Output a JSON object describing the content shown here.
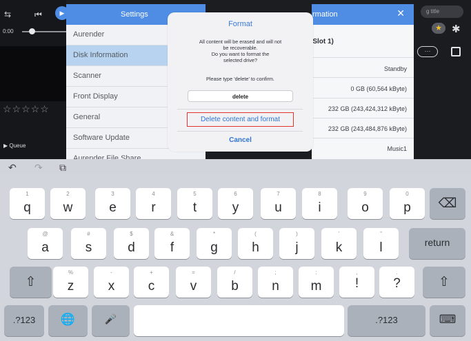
{
  "player": {
    "time_label": "0:00",
    "queue_label": "Queue",
    "stars": "☆☆☆☆☆",
    "play_glyph": "▶",
    "prev_glyph": "⏮",
    "list_glyph": "⇆"
  },
  "settings": {
    "title": "Settings",
    "items": [
      {
        "label": "Aurender"
      },
      {
        "label": "Disk Information"
      },
      {
        "label": "Scanner"
      },
      {
        "label": "Front Display"
      },
      {
        "label": "General"
      },
      {
        "label": "Software Update"
      },
      {
        "label": "Aurender File Share"
      }
    ],
    "selected_index": 1
  },
  "info": {
    "title": "rmation",
    "close_glyph": "✕",
    "slot": "(Slot 1)",
    "rows": [
      "Standby",
      "0 GB (60,564 kByte)",
      "232 GB (243,424,312 kByte)",
      "232 GB (243,484,876 kByte)",
      "Music1"
    ]
  },
  "rightbar": {
    "search_placeholder": "g title",
    "star_glyph": "★",
    "gear_glyph": "✱",
    "more_glyph": "···"
  },
  "dialog": {
    "title": "Format",
    "message_line1": "All content will be erased and will not",
    "message_line2": "be recoverable.",
    "message_line3": "Do you want to format the",
    "message_line4": "selected drive?",
    "instruction": "Please type 'delete' to confirm.",
    "input_value": "delete",
    "delete_button": "Delete content and format",
    "cancel_button": "Cancel",
    "accent": "#2f74d5",
    "highlight": "#e2342f"
  },
  "keyboard": {
    "toolbar": {
      "undo": "↶",
      "redo": "↷",
      "paste": "⧉"
    },
    "row1": [
      {
        "main": "q",
        "hint": "1"
      },
      {
        "main": "w",
        "hint": "2"
      },
      {
        "main": "e",
        "hint": "3"
      },
      {
        "main": "r",
        "hint": "4"
      },
      {
        "main": "t",
        "hint": "5"
      },
      {
        "main": "y",
        "hint": "6"
      },
      {
        "main": "u",
        "hint": "7"
      },
      {
        "main": "i",
        "hint": "8"
      },
      {
        "main": "o",
        "hint": "9"
      },
      {
        "main": "p",
        "hint": "0"
      }
    ],
    "backspace": "⌫",
    "row2": [
      {
        "main": "a",
        "hint": "@"
      },
      {
        "main": "s",
        "hint": "#"
      },
      {
        "main": "d",
        "hint": "$"
      },
      {
        "main": "f",
        "hint": "&"
      },
      {
        "main": "g",
        "hint": "*"
      },
      {
        "main": "h",
        "hint": "("
      },
      {
        "main": "j",
        "hint": ")"
      },
      {
        "main": "k",
        "hint": "’"
      },
      {
        "main": "l",
        "hint": "\""
      }
    ],
    "return_label": "return",
    "shift_glyph": "⇧",
    "row3": [
      {
        "main": "z",
        "hint": "%"
      },
      {
        "main": "x",
        "hint": "-"
      },
      {
        "main": "c",
        "hint": "+"
      },
      {
        "main": "v",
        "hint": "="
      },
      {
        "main": "b",
        "hint": "/"
      },
      {
        "main": "n",
        "hint": ";"
      },
      {
        "main": "m",
        "hint": ":"
      },
      {
        "main": "!",
        "hint": ","
      },
      {
        "main": "?",
        "hint": "."
      }
    ],
    "numbers_label": ".?123",
    "globe_glyph": "🌐",
    "mic_glyph": "🎤",
    "hide_glyph": "⌨"
  }
}
